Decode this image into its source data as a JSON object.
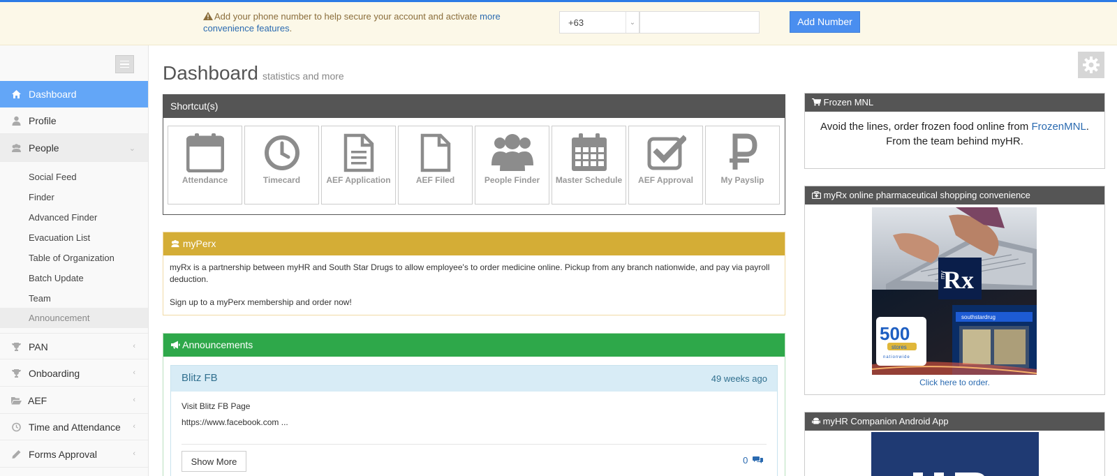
{
  "notice": {
    "message": "Add your phone number to help secure your account and activate ",
    "link_text": "more convenience features",
    "trailing": ".",
    "country_code": "+63",
    "phone_value": "",
    "add_button": "Add Number"
  },
  "sidebar": {
    "items": [
      {
        "label": "Dashboard"
      },
      {
        "label": "Profile"
      },
      {
        "label": "People"
      },
      {
        "label": "PAN"
      },
      {
        "label": "Onboarding"
      },
      {
        "label": "AEF"
      },
      {
        "label": "Time and Attendance"
      },
      {
        "label": "Forms Approval"
      }
    ],
    "people_sub": [
      {
        "label": "Social Feed"
      },
      {
        "label": "Finder"
      },
      {
        "label": "Advanced Finder"
      },
      {
        "label": "Evacuation List"
      },
      {
        "label": "Table of Organization"
      },
      {
        "label": "Batch Update"
      },
      {
        "label": "Team"
      },
      {
        "label": "Announcement"
      }
    ]
  },
  "page": {
    "title": "Dashboard",
    "subtitle": "statistics and more"
  },
  "shortcuts": {
    "title": "Shortcut(s)",
    "tiles": [
      {
        "label": "Attendance",
        "icon": "calendar-icon"
      },
      {
        "label": "Timecard",
        "icon": "clock-icon"
      },
      {
        "label": "AEF Application",
        "icon": "document-icon"
      },
      {
        "label": "AEF Filed",
        "icon": "file-icon"
      },
      {
        "label": "People Finder",
        "icon": "people-icon"
      },
      {
        "label": "Master Schedule",
        "icon": "schedule-icon"
      },
      {
        "label": "AEF Approval",
        "icon": "check-square-icon"
      },
      {
        "label": "My Payslip",
        "icon": "peso-icon"
      }
    ]
  },
  "perx": {
    "title": "myPerx",
    "para1": "myRx is a partnership between myHR and South Star Drugs to allow employee's to order medicine online. Pickup from any branch nationwide, and pay via payroll deduction.",
    "para2": "Sign up to a myPerx membership and order now!"
  },
  "announcements": {
    "title": "Announcements",
    "post": {
      "title": "Blitz FB",
      "time": "49 weeks ago",
      "line1": "Visit Blitz FB Page",
      "line2": "https://www.facebook.com ...",
      "show_more": "Show More",
      "comment_count": "0"
    }
  },
  "right": {
    "frozen": {
      "title": "Frozen MNL",
      "text_before": "Avoid the lines, order frozen food online from ",
      "link": "FrozenMNL",
      "text_after": ". From the team behind myHR."
    },
    "myrx": {
      "title": "myRx online pharmaceutical shopping convenience",
      "img_brand": "Rx",
      "img_my": "my",
      "img_stores_num": "500",
      "img_stores_word": "stores",
      "img_nationwide": "nationwide",
      "img_sign": "southstardrug",
      "link": "Click here to order."
    },
    "companion": {
      "title": "myHR Companion Android App"
    }
  },
  "colors": {
    "accent": "#63a6f7",
    "notice_bg": "#fcf8e8",
    "perx_header": "#d4ad36",
    "ann_header": "#2ea84a",
    "dark_header": "#555555"
  }
}
